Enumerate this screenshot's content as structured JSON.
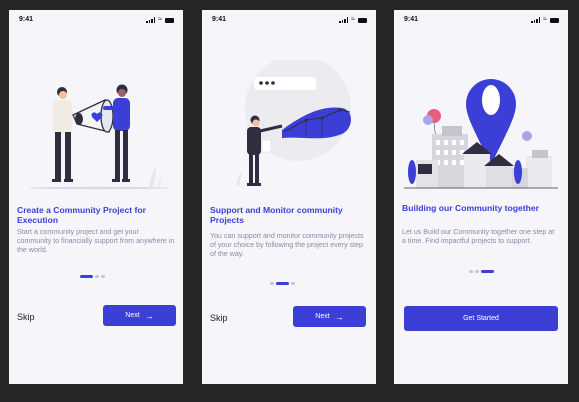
{
  "status_time": "9:41",
  "colors": {
    "accent": "#3b3fd6",
    "background": "#262626",
    "screen": "#f6f5fa"
  },
  "screens": [
    {
      "title": "Create a Community Project for Execution",
      "description": "Start a community  project and get your community to financially support from anywhere in the world.",
      "page_indicator": {
        "current": 1,
        "total": 3
      },
      "skip_label": "Skip",
      "next_label": "Next",
      "next_icon": "arrow-right-icon"
    },
    {
      "title": "Support and Monitor community Projects",
      "description": "You can support and monitor community projects of your choice by following the project every step of the way.",
      "page_indicator": {
        "current": 2,
        "total": 3
      },
      "skip_label": "Skip",
      "next_label": "Next",
      "next_icon": "arrow-right-icon"
    },
    {
      "title": "Building our Community together",
      "description": "Let us Build our Community together one step at a time. Find impactful projects to support.",
      "page_indicator": {
        "current": 3,
        "total": 3
      },
      "primary_label": "Get Started"
    }
  ]
}
